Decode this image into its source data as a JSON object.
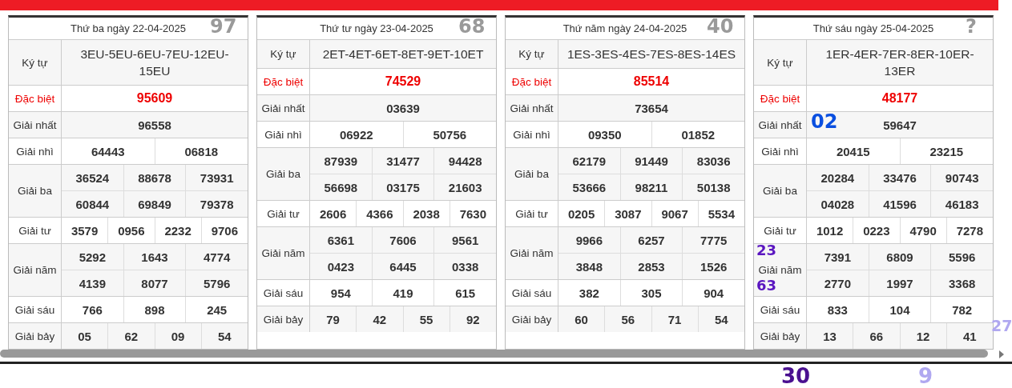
{
  "days": [
    {
      "title": "Thứ ba ngày 22-04-2025",
      "code_label": "Ký tự",
      "code": "3EU-5EU-6EU-7EU-12EU-15EU",
      "prizes": [
        {
          "label": "Đặc biệt",
          "kind": "special",
          "rows": [
            [
              "95609"
            ]
          ]
        },
        {
          "label": "Giải nhất",
          "kind": "normal",
          "rows": [
            [
              "96558"
            ]
          ]
        },
        {
          "label": "Giải nhì",
          "kind": "normal",
          "rows": [
            [
              "64443",
              "06818"
            ]
          ]
        },
        {
          "label": "Giải ba",
          "kind": "normal",
          "rows": [
            [
              "36524",
              "88678",
              "73931"
            ],
            [
              "60844",
              "69849",
              "79378"
            ]
          ]
        },
        {
          "label": "Giải tư",
          "kind": "normal",
          "rows": [
            [
              "3579",
              "0956",
              "2232",
              "9706"
            ]
          ]
        },
        {
          "label": "Giải năm",
          "kind": "normal",
          "rows": [
            [
              "5292",
              "1643",
              "4774"
            ],
            [
              "4139",
              "8077",
              "5796"
            ]
          ]
        },
        {
          "label": "Giải sáu",
          "kind": "normal",
          "rows": [
            [
              "766",
              "898",
              "245"
            ]
          ]
        },
        {
          "label": "Giải bảy",
          "kind": "normal",
          "rows": [
            [
              "05",
              "62",
              "09",
              "54"
            ]
          ]
        }
      ]
    },
    {
      "title": "Thứ tư ngày 23-04-2025",
      "code_label": "Ký tự",
      "code": "2ET-4ET-6ET-8ET-9ET-10ET",
      "prizes": [
        {
          "label": "Đặc biệt",
          "kind": "special",
          "rows": [
            [
              "74529"
            ]
          ]
        },
        {
          "label": "Giải nhất",
          "kind": "normal",
          "rows": [
            [
              "03639"
            ]
          ]
        },
        {
          "label": "Giải nhì",
          "kind": "normal",
          "rows": [
            [
              "06922",
              "50756"
            ]
          ]
        },
        {
          "label": "Giải ba",
          "kind": "normal",
          "rows": [
            [
              "87939",
              "31477",
              "94428"
            ],
            [
              "56698",
              "03175",
              "21603"
            ]
          ]
        },
        {
          "label": "Giải tư",
          "kind": "normal",
          "rows": [
            [
              "2606",
              "4366",
              "2038",
              "7630"
            ]
          ]
        },
        {
          "label": "Giải năm",
          "kind": "normal",
          "rows": [
            [
              "6361",
              "7606",
              "9561"
            ],
            [
              "0423",
              "6445",
              "0338"
            ]
          ]
        },
        {
          "label": "Giải sáu",
          "kind": "normal",
          "rows": [
            [
              "954",
              "419",
              "615"
            ]
          ]
        },
        {
          "label": "Giải bảy",
          "kind": "normal",
          "rows": [
            [
              "79",
              "42",
              "55",
              "92"
            ]
          ]
        }
      ]
    },
    {
      "title": "Thứ năm ngày 24-04-2025",
      "code_label": "Ký tự",
      "code": "1ES-3ES-4ES-7ES-8ES-14ES",
      "prizes": [
        {
          "label": "Đặc biệt",
          "kind": "special",
          "rows": [
            [
              "85514"
            ]
          ]
        },
        {
          "label": "Giải nhất",
          "kind": "normal",
          "rows": [
            [
              "73654"
            ]
          ]
        },
        {
          "label": "Giải nhì",
          "kind": "normal",
          "rows": [
            [
              "09350",
              "01852"
            ]
          ]
        },
        {
          "label": "Giải ba",
          "kind": "normal",
          "rows": [
            [
              "62179",
              "91449",
              "83036"
            ],
            [
              "53666",
              "98211",
              "50138"
            ]
          ]
        },
        {
          "label": "Giải tư",
          "kind": "normal",
          "rows": [
            [
              "0205",
              "3087",
              "9067",
              "5534"
            ]
          ]
        },
        {
          "label": "Giải năm",
          "kind": "normal",
          "rows": [
            [
              "9966",
              "6257",
              "7775"
            ],
            [
              "3848",
              "2853",
              "1526"
            ]
          ]
        },
        {
          "label": "Giải sáu",
          "kind": "normal",
          "rows": [
            [
              "382",
              "305",
              "904"
            ]
          ]
        },
        {
          "label": "Giải bảy",
          "kind": "normal",
          "rows": [
            [
              "60",
              "56",
              "71",
              "54"
            ]
          ]
        }
      ]
    },
    {
      "title": "Thứ sáu ngày 25-04-2025",
      "code_label": "Ký tự",
      "code": "1ER-4ER-7ER-8ER-10ER-13ER",
      "prizes": [
        {
          "label": "Đặc biệt",
          "kind": "special",
          "rows": [
            [
              "48177"
            ]
          ]
        },
        {
          "label": "Giải nhất",
          "kind": "normal",
          "rows": [
            [
              "59647"
            ]
          ]
        },
        {
          "label": "Giải nhì",
          "kind": "normal",
          "rows": [
            [
              "20415",
              "23215"
            ]
          ]
        },
        {
          "label": "Giải ba",
          "kind": "normal",
          "rows": [
            [
              "20284",
              "33476",
              "90743"
            ],
            [
              "04028",
              "41596",
              "46183"
            ]
          ]
        },
        {
          "label": "Giải tư",
          "kind": "normal",
          "rows": [
            [
              "1012",
              "0223",
              "4790",
              "7278"
            ]
          ]
        },
        {
          "label": "Giải năm",
          "kind": "normal",
          "rows": [
            [
              "7391",
              "6809",
              "5596"
            ],
            [
              "2770",
              "1997",
              "3368"
            ]
          ]
        },
        {
          "label": "Giải sáu",
          "kind": "normal",
          "rows": [
            [
              "833",
              "104",
              "782"
            ]
          ]
        },
        {
          "label": "Giải bảy",
          "kind": "normal",
          "rows": [
            [
              "13",
              "66",
              "12",
              "41"
            ]
          ]
        }
      ]
    }
  ],
  "handwritten_notes": [
    {
      "text": "97",
      "color": "#9a9a9a"
    },
    {
      "text": "68",
      "color": "#9a9a9a"
    },
    {
      "text": "40",
      "color": "#9a9a9a"
    },
    {
      "text": "?",
      "color": "#9a9a9a"
    },
    {
      "text": "02",
      "color": "#0a4fe0"
    },
    {
      "text": "23",
      "color": "#5a16c0"
    },
    {
      "text": "63",
      "color": "#5a16c0"
    },
    {
      "text": "30",
      "color": "#4a1090"
    },
    {
      "text": "27",
      "color": "#b0a8f0"
    },
    {
      "text": "9",
      "color": "#b0a8f0"
    }
  ]
}
